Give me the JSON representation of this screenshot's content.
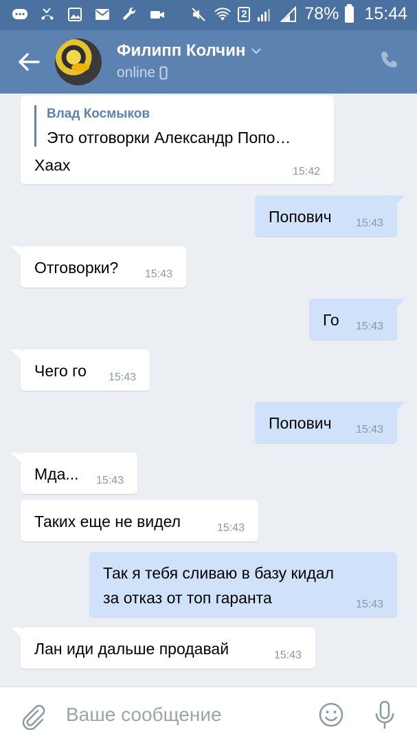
{
  "status_bar": {
    "battery": "78%",
    "time": "15:44",
    "sim_badge": "2"
  },
  "header": {
    "name": "Филипп Колчин",
    "status": "online"
  },
  "messages": [
    {
      "direction": "in",
      "reply": {
        "author": "Влад Космыков",
        "text": "Это отговорки Александр Попо…"
      },
      "text": "Хаах",
      "time": "15:42"
    },
    {
      "direction": "out",
      "text": "Попович",
      "time": "15:43"
    },
    {
      "direction": "in",
      "text": "Отговорки?",
      "time": "15:43"
    },
    {
      "direction": "out",
      "text": "Го",
      "time": "15:43"
    },
    {
      "direction": "in",
      "text": "Чего го",
      "time": "15:43"
    },
    {
      "direction": "out",
      "text": "Попович",
      "time": "15:43"
    },
    {
      "direction": "in",
      "text": "Мда...",
      "time": "15:43"
    },
    {
      "direction": "in",
      "text": "Таких еще не видел",
      "time": "15:43"
    },
    {
      "direction": "out",
      "text_line1": "Так  я тебя сливаю в базу кидал",
      "text_line2": "за отказ от топ гаранта",
      "time": "15:43"
    },
    {
      "direction": "in",
      "text": "Лан иди дальше продавай",
      "time": "15:43"
    }
  ],
  "composer": {
    "placeholder": "Ваше сообщение"
  },
  "colors": {
    "status_bar": "#4b71a0",
    "header": "#5b82b0",
    "background": "#ebeff3",
    "incoming": "#ffffff",
    "outgoing": "#cfe2f9",
    "accent": "#5b82b0"
  }
}
